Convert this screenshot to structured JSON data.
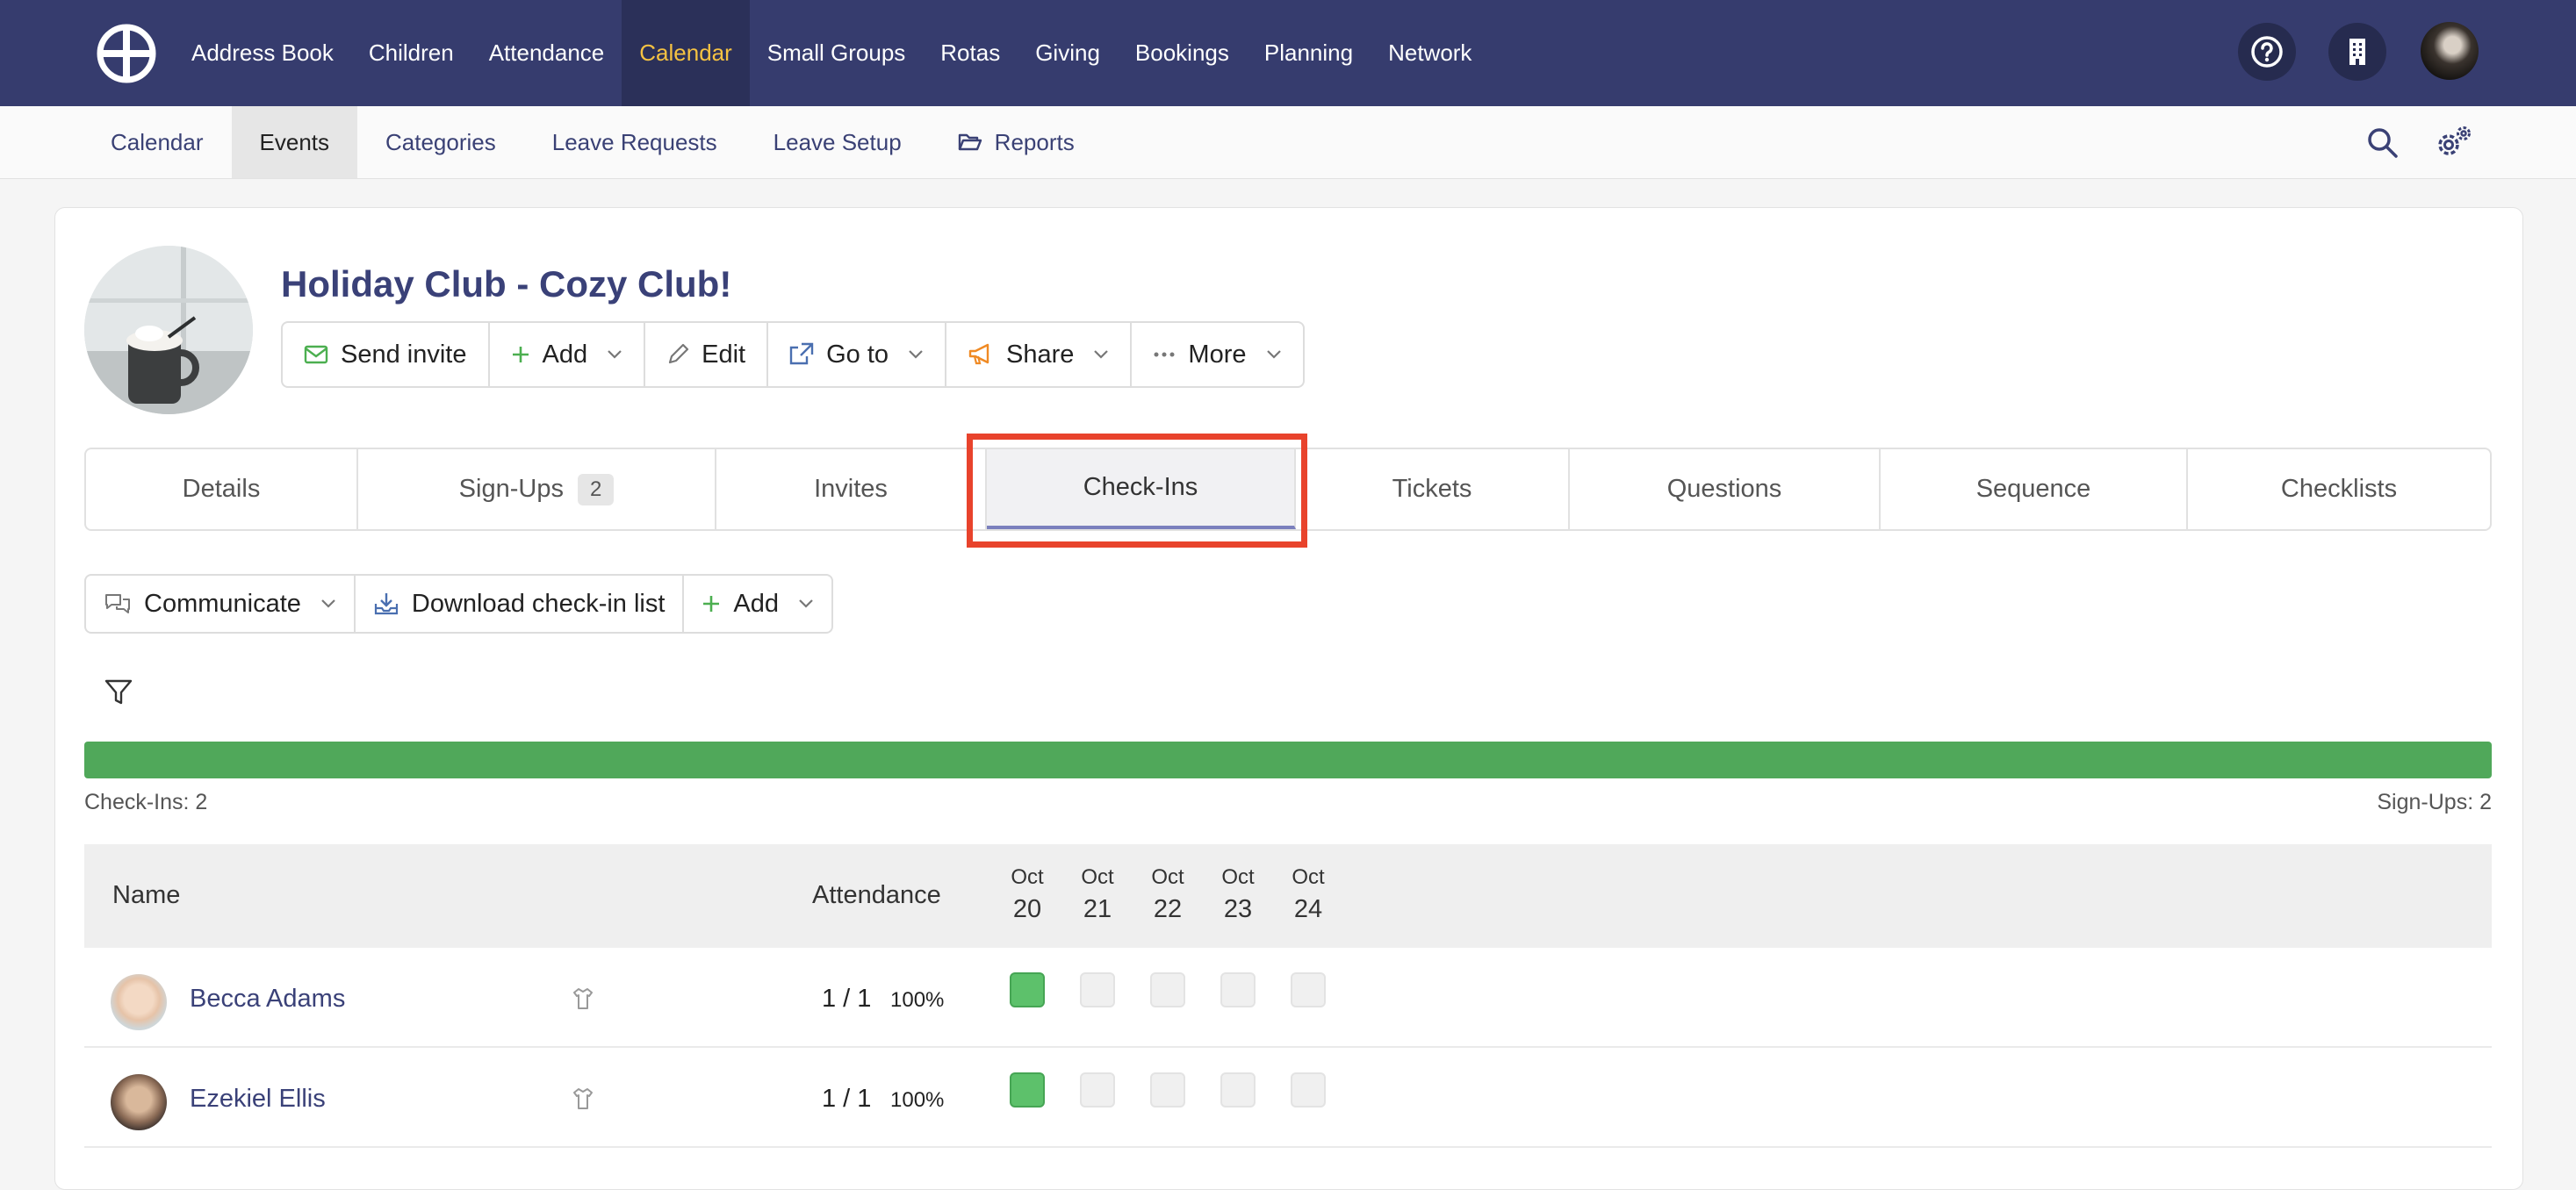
{
  "topnav": {
    "items": [
      "Address Book",
      "Children",
      "Attendance",
      "Calendar",
      "Small Groups",
      "Rotas",
      "Giving",
      "Bookings",
      "Planning",
      "Network"
    ],
    "active_index": 3,
    "active_color": "#f5c242",
    "bg_color": "#363c6e"
  },
  "subnav": {
    "items": [
      "Calendar",
      "Events",
      "Categories",
      "Leave Requests",
      "Leave Setup",
      "Reports"
    ],
    "active_index": 1
  },
  "event": {
    "title": "Holiday Club - Cozy Club!",
    "actions": {
      "send_invite": "Send invite",
      "add": "Add",
      "edit": "Edit",
      "go_to": "Go to",
      "share": "Share",
      "more": "More"
    }
  },
  "tabs": {
    "details": "Details",
    "signups": "Sign-Ups",
    "signups_badge": "2",
    "invites": "Invites",
    "checkins": "Check-Ins",
    "tickets": "Tickets",
    "questions": "Questions",
    "sequence": "Sequence",
    "checklists": "Checklists",
    "active": "Check-Ins"
  },
  "toolbar": {
    "communicate": "Communicate",
    "download": "Download check-in list",
    "add": "Add"
  },
  "progress": {
    "checkins_label": "Check-Ins: 2",
    "signups_label": "Sign-Ups: 2",
    "fill_fraction": 1.0,
    "color": "#50a85a"
  },
  "table": {
    "headers": {
      "name": "Name",
      "attendance": "Attendance"
    },
    "dates": [
      {
        "month": "Oct",
        "day": "20"
      },
      {
        "month": "Oct",
        "day": "21"
      },
      {
        "month": "Oct",
        "day": "22"
      },
      {
        "month": "Oct",
        "day": "23"
      },
      {
        "month": "Oct",
        "day": "24"
      }
    ],
    "rows": [
      {
        "name": "Becca Adams",
        "ratio": "1 / 1",
        "pct": "100%",
        "checked": [
          true,
          false,
          false,
          false,
          false
        ]
      },
      {
        "name": "Ezekiel Ellis",
        "ratio": "1 / 1",
        "pct": "100%",
        "checked": [
          true,
          false,
          false,
          false,
          false
        ]
      }
    ]
  }
}
